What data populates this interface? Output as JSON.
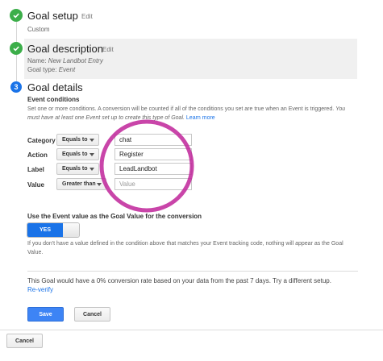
{
  "goal_setup": {
    "title": "Goal setup",
    "edit": "Edit",
    "value": "Custom"
  },
  "goal_description": {
    "title": "Goal description",
    "edit": "Edit",
    "name_label": "Name:",
    "name_value": "New Landbot Entry",
    "type_label": "Goal type:",
    "type_value": "Event"
  },
  "goal_details": {
    "step_number": "3",
    "title": "Goal details",
    "conditions_heading": "Event conditions",
    "conditions_desc": "Set one or more conditions. A conversion will be counted if all of the conditions you set are true when an Event is triggered.",
    "conditions_desc_italic": "You must have at least one Event set up to create this type of Goal.",
    "learn_more": "Learn more",
    "conditions": [
      {
        "label": "Category",
        "operator": "Equals to",
        "value": "chat",
        "placeholder": ""
      },
      {
        "label": "Action",
        "operator": "Equals to",
        "value": "Register",
        "placeholder": ""
      },
      {
        "label": "Label",
        "operator": "Equals to",
        "value": "LeadLandbot",
        "placeholder": ""
      },
      {
        "label": "Value",
        "operator": "Greater than",
        "value": "",
        "placeholder": "Value"
      }
    ],
    "event_value_heading": "Use the Event value as the Goal Value for the conversion",
    "toggle_label": "YES",
    "toggle_on": true,
    "event_value_note": "If you don't have a value defined in the condition above that matches your Event tracking code, nothing will appear as the Goal Value.",
    "conversion_text": "This Goal would have a 0% conversion rate based on your data from the past 7 days. Try a different setup.",
    "reverify": "Re-verify",
    "save": "Save",
    "cancel": "Cancel"
  },
  "footer": {
    "cancel": "Cancel"
  },
  "colors": {
    "accent": "#1a73e8",
    "check_green": "#3cae4a",
    "highlight_circle": "#c0259a"
  },
  "icons": {
    "done": "check-icon",
    "dropdown": "caret-down-icon"
  }
}
